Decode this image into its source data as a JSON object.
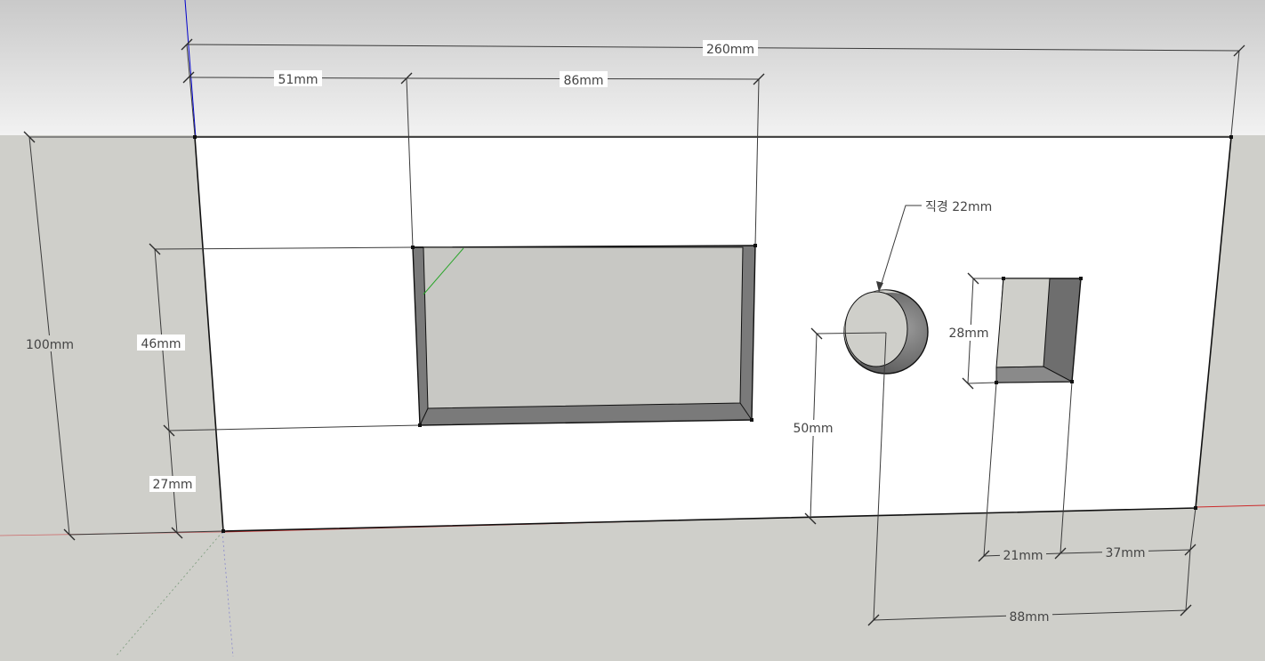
{
  "colors": {
    "sky_top": "#c9c9c9",
    "sky_bottom": "#f2f2f2",
    "ground": "#cfcfca",
    "panel": "#ffffff",
    "recess_dark": "#7a7a7a",
    "recess_floor": "#c8c8c4",
    "axis_blue": "#0000cc",
    "axis_red": "#cc2a2a",
    "axis_green": "#2aa52a"
  },
  "dimensions": {
    "total_width": "260mm",
    "left_offset": "51mm",
    "window_width": "86mm",
    "panel_height": "100mm",
    "window_height": "46mm",
    "window_bottom_offset": "27mm",
    "hole_center_height": "50mm",
    "slot_height": "28mm",
    "slot_width": "21mm",
    "slot_right_offset": "37mm",
    "hole_center_right_offset": "88mm"
  },
  "annotations": {
    "hole_diameter": "직경 22mm"
  }
}
